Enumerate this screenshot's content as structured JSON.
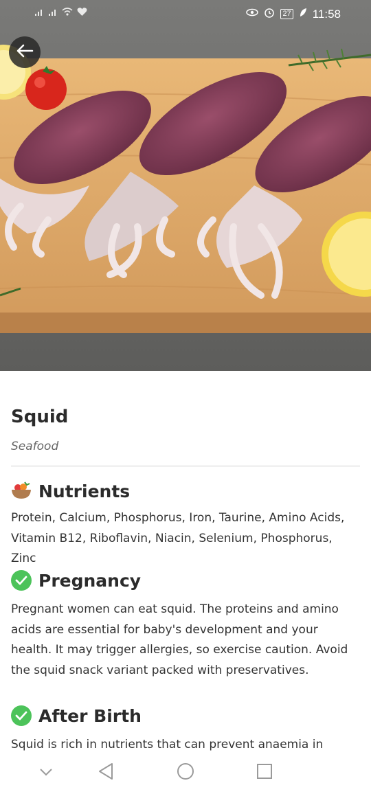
{
  "status_bar": {
    "time": "11:58",
    "battery": "27"
  },
  "hero": {
    "image_icon": "squid-photo"
  },
  "food": {
    "name": "Squid",
    "category": "Seafood"
  },
  "sections": [
    {
      "title": "Nutrients",
      "icon": "food-bowl-icon",
      "body": "Protein, Calcium, Phosphorus, Iron, Taurine, Amino Acids, Vitamin B12, Riboflavin, Niacin, Selenium, Phosphorus, Zinc"
    },
    {
      "title": "Pregnancy",
      "icon": "check-circle-icon",
      "body": "Pregnant women can eat squid. The proteins and amino acids are essential for baby's development and your health. It may trigger allergies, so exercise caution. Avoid the squid snack variant packed with preservatives."
    },
    {
      "title": "After Birth",
      "icon": "check-circle-icon",
      "body": "Squid is rich in nutrients that can prevent anaemia in"
    }
  ],
  "colors": {
    "accent_green": "#4cc35a",
    "divider": "#cfcfcf"
  }
}
